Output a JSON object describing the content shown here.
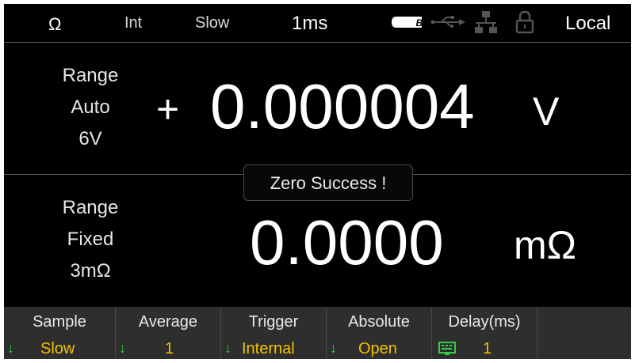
{
  "status_bar": {
    "mode": "Ω",
    "trigger_source": "Int",
    "speed": "Slow",
    "interval": "1ms",
    "battery_label": "B",
    "remote_state": "Local"
  },
  "icons": {
    "battery": "battery-icon",
    "usb": "usb-icon",
    "lan": "network-icon",
    "lock": "lock-icon"
  },
  "voltage_panel": {
    "range_title": "Range",
    "range_mode": "Auto",
    "range_value": "6V",
    "sign": "+",
    "reading": "0.000004",
    "unit": "V"
  },
  "toast": {
    "message": "Zero Success !"
  },
  "resistance_panel": {
    "range_title": "Range",
    "range_mode": "Fixed",
    "range_value": "3mΩ",
    "reading": "0.0000",
    "unit": "mΩ"
  },
  "softkeys": [
    {
      "label": "Sample",
      "value": "Slow"
    },
    {
      "label": "Average",
      "value": "1"
    },
    {
      "label": "Trigger",
      "value": "Internal"
    },
    {
      "label": "Absolute",
      "value": "Open"
    },
    {
      "label": "Delay(ms)",
      "value": "1"
    },
    {
      "label": "",
      "value": ""
    }
  ],
  "colors": {
    "background": "#000000",
    "softkey_value": "#f2c200",
    "softkey_arrow": "#2fd23f",
    "softkey_bar": "#2e2e2e"
  }
}
